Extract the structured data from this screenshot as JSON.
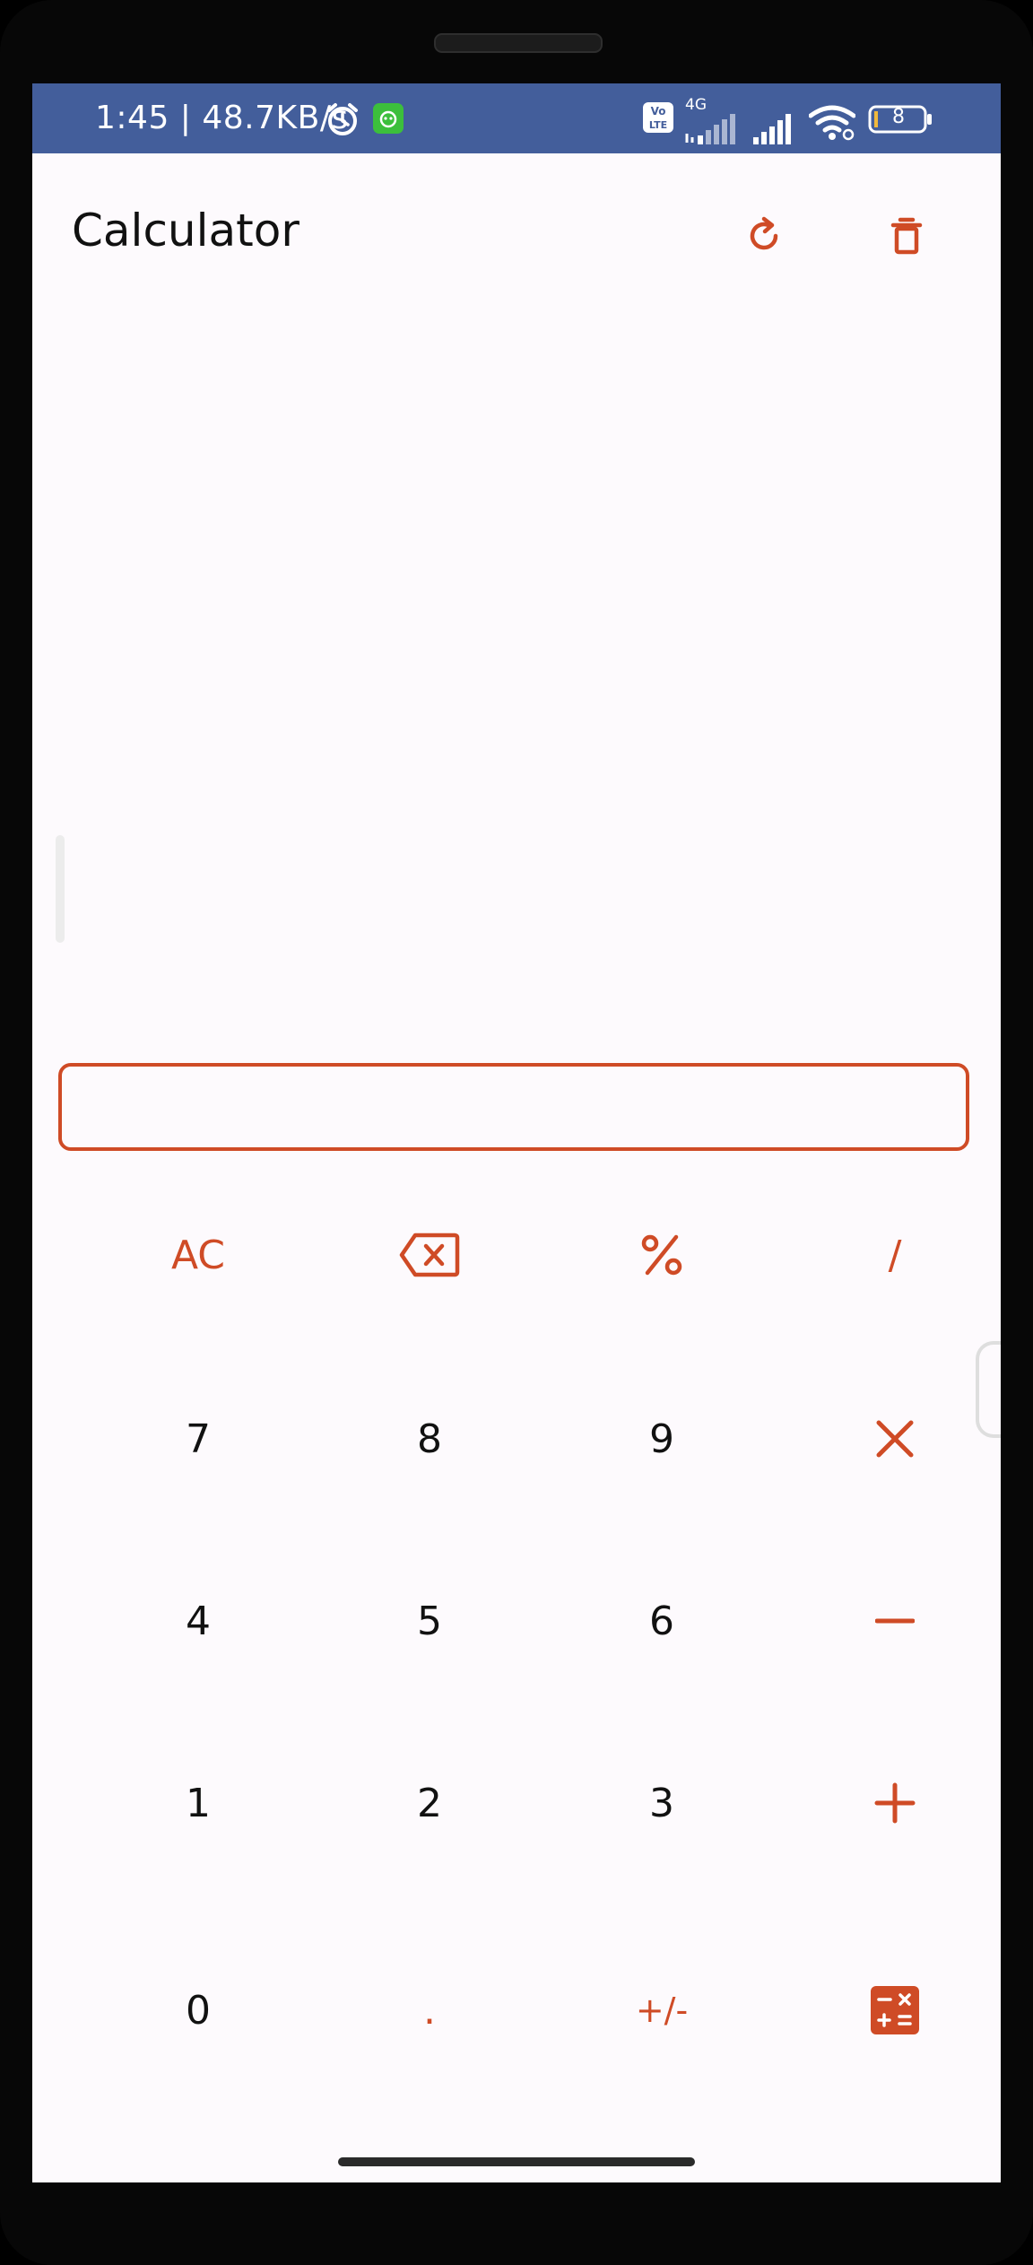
{
  "status_bar": {
    "time_speed": "1:45 | 48.7KB/s",
    "volte": "Vo\nLTE",
    "network": "4G",
    "battery": "8"
  },
  "app_bar": {
    "title": "Calculator"
  },
  "display": {
    "value": "",
    "placeholder": ""
  },
  "keypad": {
    "rows": [
      [
        "AC",
        "⌫",
        "%",
        "/"
      ],
      [
        "7",
        "8",
        "9",
        "×"
      ],
      [
        "4",
        "5",
        "6",
        "−"
      ],
      [
        "1",
        "2",
        "3",
        "+"
      ],
      [
        "0",
        ".",
        "+/-",
        "="
      ]
    ]
  },
  "colors": {
    "accent": "#cf4b26",
    "status_bar_bg": "#435e9b",
    "screen_bg": "#fdfafd",
    "text": "#111111"
  },
  "icons": {
    "refresh": "refresh-icon",
    "delete": "trash-icon",
    "backspace": "backspace-icon",
    "equals": "calculator-icon"
  }
}
